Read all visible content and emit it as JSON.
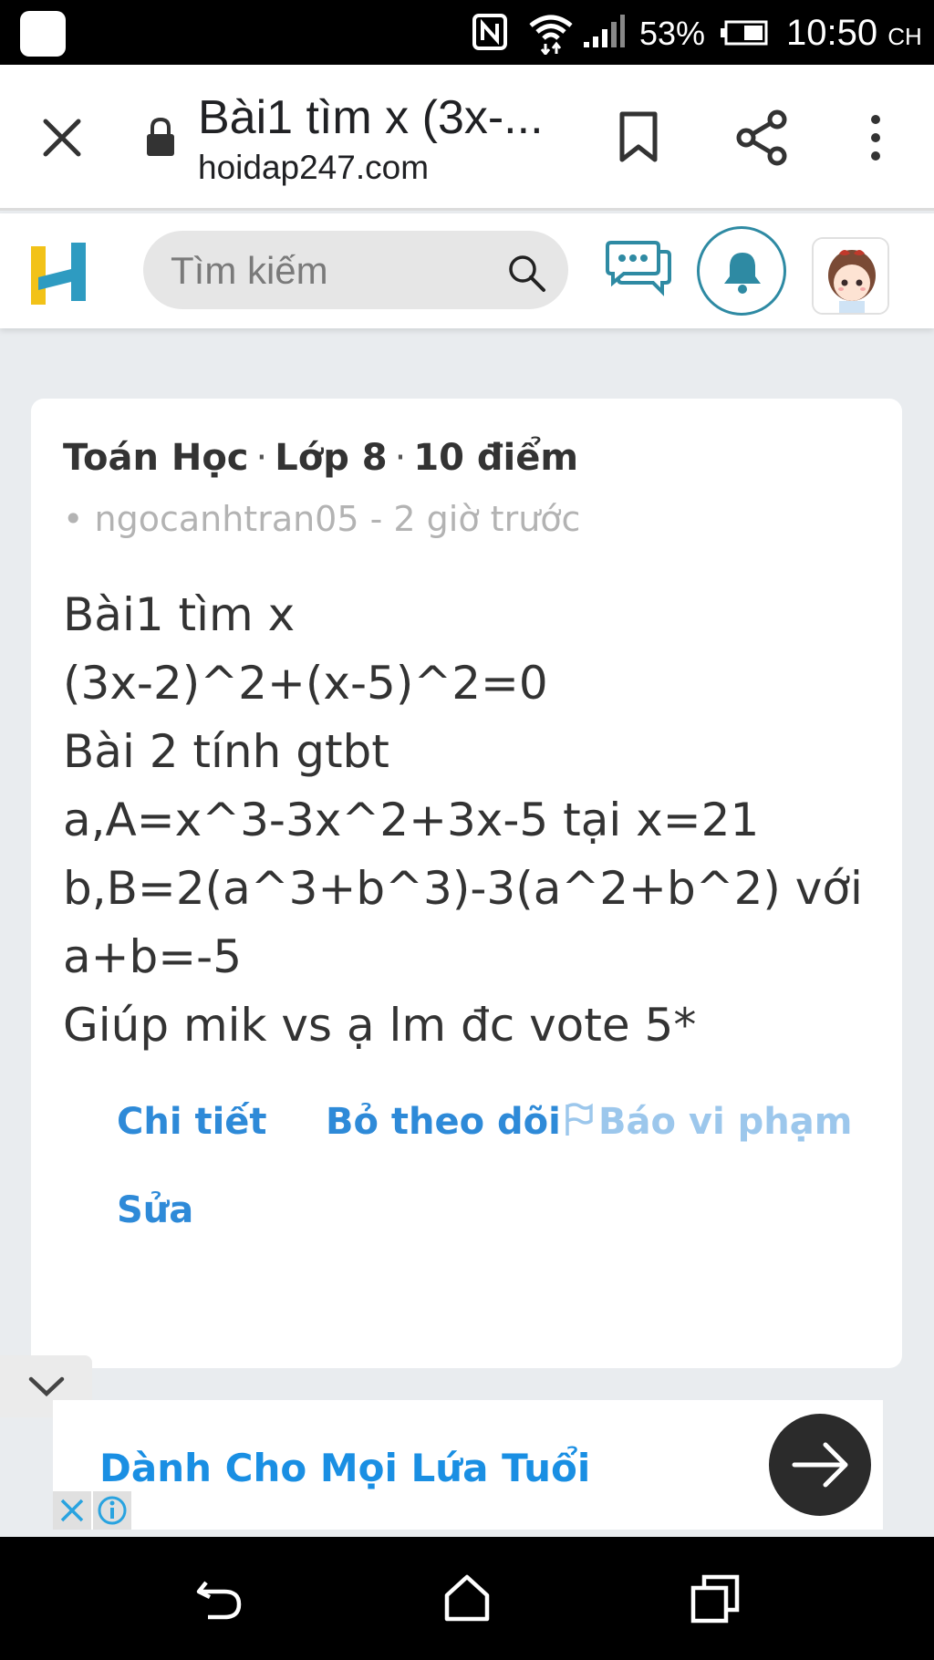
{
  "status_bar": {
    "battery_percent": "53%",
    "time": "10:50",
    "time_suffix": "CH",
    "icons": [
      "app-notification-icon",
      "nfc-icon",
      "wifi-icon",
      "signal-icon",
      "battery-icon"
    ]
  },
  "browser": {
    "page_title": "Bài1 tìm x (3x-...",
    "domain": "hoidap247.com",
    "icons": [
      "close-icon",
      "lock-icon",
      "bookmark-icon",
      "share-icon",
      "more-vert-icon"
    ]
  },
  "site_nav": {
    "search_placeholder": "Tìm kiếm",
    "icons": [
      "hoidap247-logo",
      "search-icon",
      "chat-icon",
      "bell-icon",
      "avatar"
    ]
  },
  "question": {
    "subject": "Toán Học",
    "grade": "Lớp 8",
    "points": "10 điểm",
    "separator": "·",
    "author_line": "• ngocanhtran05 - 2 giờ trước",
    "body_lines": [
      "Bài1 tìm x",
      "(3x-2)^2+(x-5)^2=0",
      "Bài 2 tính gtbt",
      "a,A=x^3-3x^2+3x-5 tại x=21",
      "b,B=2(a^3+b^3)-3(a^2+b^2) với",
      "a+b=-5",
      "Giúp mik vs ạ lm đc vote 5*"
    ],
    "actions": {
      "detail": "Chi tiết",
      "unfollow": "Bỏ theo dõi",
      "report": "Báo vi phạm",
      "edit": "Sửa"
    }
  },
  "ad": {
    "text": "Dành Cho Mọi Lứa Tuổi"
  },
  "colors": {
    "link_blue": "#2e8ad8",
    "report_blue": "#9cc7ec",
    "ad_blue": "#1a8fe3",
    "logo_yellow": "#f2c218",
    "logo_teal": "#2e9bc1",
    "bell_teal": "#2e8aa3"
  }
}
